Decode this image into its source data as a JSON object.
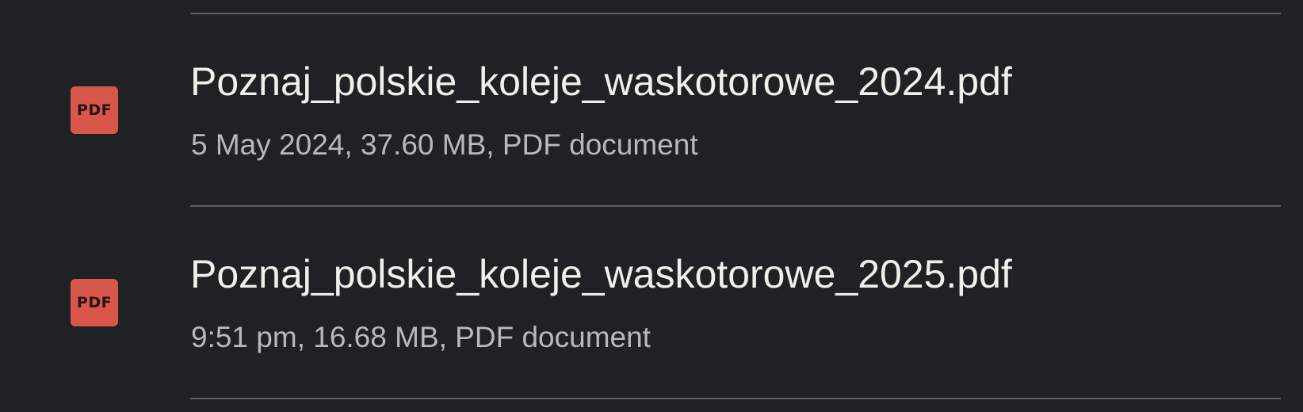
{
  "files": [
    {
      "icon": "pdf-file-icon",
      "icon_text": "PDF",
      "name": "Poznaj_polskie_koleje_waskotorowe_2024.pdf",
      "details": "5 May 2024, 37.60 MB, PDF document"
    },
    {
      "icon": "pdf-file-icon",
      "icon_text": "PDF",
      "name": "Poznaj_polskie_koleje_waskotorowe_2025.pdf",
      "details": "9:51 pm, 16.68 MB, PDF document"
    }
  ],
  "colors": {
    "background": "#202124",
    "divider": "#5f6064",
    "pdf_icon": "#d9574a",
    "primary_text": "#f1efea",
    "secondary_text": "#b9b9bb"
  }
}
